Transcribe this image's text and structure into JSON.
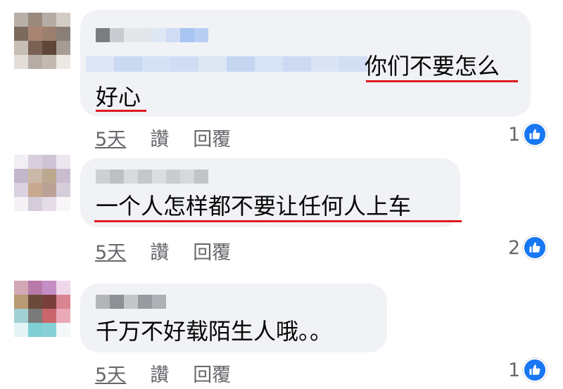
{
  "colors": {
    "bubble_bg": "#f0f2f5",
    "text": "#050505",
    "meta": "#65676b",
    "like_blue": "#1877f2",
    "underline_red": "#e0191f"
  },
  "comments": [
    {
      "author": "",
      "text_line1": "你们不要怎么",
      "text_line2": "好心",
      "time": "5天",
      "like_label": "讚",
      "reply_label": "回覆",
      "reaction_count": "1",
      "reaction_icon": "thumbs-up-icon"
    },
    {
      "author": "",
      "text": "一个人怎样都不要让任何人上车",
      "time": "5天",
      "like_label": "讚",
      "reply_label": "回覆",
      "reaction_count": "2",
      "reaction_icon": "thumbs-up-icon"
    },
    {
      "author": "",
      "text": "千万不好载陌生人哦。。",
      "time": "5天",
      "like_label": "讚",
      "reply_label": "回覆",
      "reaction_count": "1",
      "reaction_icon": "thumbs-up-icon"
    }
  ]
}
